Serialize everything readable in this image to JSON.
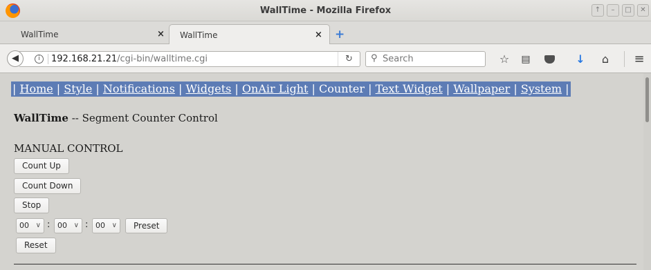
{
  "window": {
    "title": "WallTime - Mozilla Firefox",
    "controls": [
      "restore-icon",
      "minimize-icon",
      "maximize-icon",
      "close-icon"
    ]
  },
  "tabs": [
    {
      "label": "WallTime",
      "active": false
    },
    {
      "label": "WallTime",
      "active": true
    }
  ],
  "navbar": {
    "url_host": "192.168.21.21",
    "url_path": "/cgi-bin/walltime.cgi",
    "search_placeholder": "Search"
  },
  "page": {
    "menu": [
      {
        "label": "Home",
        "link": true
      },
      {
        "label": "Style",
        "link": true
      },
      {
        "label": "Notifications",
        "link": true
      },
      {
        "label": "Widgets",
        "link": true
      },
      {
        "label": "OnAir Light",
        "link": true
      },
      {
        "label": "Counter",
        "link": false
      },
      {
        "label": "Text Widget",
        "link": true
      },
      {
        "label": "Wallpaper",
        "link": true
      },
      {
        "label": "System",
        "link": true
      }
    ],
    "heading_app": "WallTime",
    "heading_rest": " -- Segment Counter Control",
    "section_title": "MANUAL CONTROL",
    "buttons": {
      "count_up": "Count Up",
      "count_down": "Count Down",
      "stop": "Stop",
      "preset": "Preset",
      "reset": "Reset"
    },
    "preset_fields": {
      "hours": "00",
      "minutes": "00",
      "seconds": "00",
      "separator": ":"
    }
  }
}
